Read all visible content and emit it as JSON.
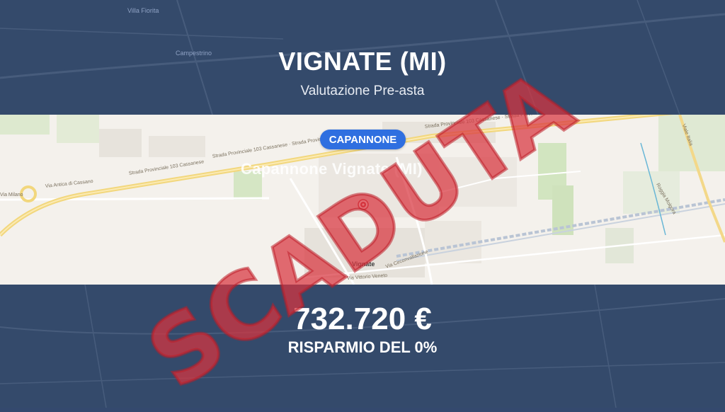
{
  "header": {
    "title": "VIGNATE (MI)",
    "subtitle": "Valutazione Pre-asta"
  },
  "map": {
    "badge": "CAPANNONE",
    "ghost_title": "Capannone Vignate (MI)",
    "town": "Vignate",
    "places": {
      "top1": "Villa Fiorita",
      "top2": "Campestrino"
    },
    "roads": {
      "antica_cassano": "Via Antica di Cassano",
      "sp103_a": "Strada Provinciale 103 Cassanese",
      "sp103_b": "Strada Provinciale 103 Cassanese · Strada Provinciale 103 Cassanese",
      "sp103_c": "Strada Provinciale 103 Cassanese · Strada Provinciale 103 Cassanese",
      "milano": "Via Milano",
      "vittorio_veneto": "Via Vittorio Veneto",
      "circonvallazione": "Via Circonvallazione",
      "viale_italia": "Viale Italia",
      "roggia": "Roggia Molgora"
    }
  },
  "pricing": {
    "price": "732.720 €",
    "savings": "RISPARMIO DEL 0%"
  },
  "stamp": {
    "text": "SCADUTA"
  },
  "colors": {
    "band": "#344a6b",
    "badge": "#2f6fe0",
    "stamp": "#d8343e",
    "pin": "#c8323a"
  }
}
